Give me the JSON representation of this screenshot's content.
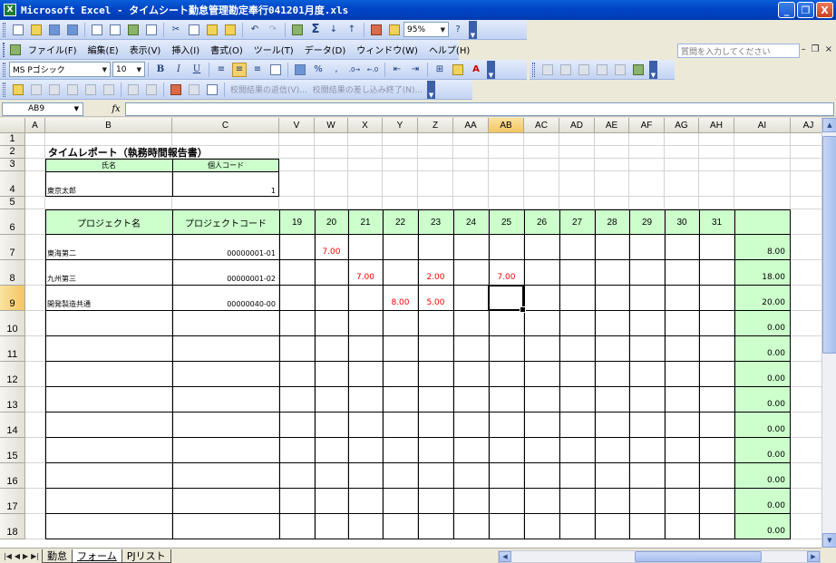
{
  "window": {
    "title": "Microsoft Excel - タイムシート勤怠管理勘定奉行041201月度.xls",
    "app_icon": "X",
    "controls": [
      "_",
      "❐",
      "X"
    ]
  },
  "menu": {
    "items": [
      "ファイル(F)",
      "編集(E)",
      "表示(V)",
      "挿入(I)",
      "書式(O)",
      "ツール(T)",
      "データ(D)",
      "ウィンドウ(W)",
      "ヘルプ(H)"
    ],
    "help_placeholder": "質問を入力してください",
    "mdi_controls": [
      "–",
      "❐",
      "×"
    ]
  },
  "toolbar": {
    "zoom": "95%",
    "font": "MS Pゴシック",
    "font_size": "10",
    "bold": "B",
    "italic": "I",
    "underline": "U",
    "percent": "%",
    "comma": ",",
    "review_send": "校閲結果の返信(V)...",
    "review_end": "校閲結果の差し込み終了(N)..."
  },
  "formula_bar": {
    "name_box": "AB9",
    "fx_label": "fx",
    "formula": ""
  },
  "columns": [
    "A",
    "B",
    "C",
    "V",
    "W",
    "X",
    "Y",
    "Z",
    "AA",
    "AB",
    "AC",
    "AD",
    "AE",
    "AF",
    "AG",
    "AH",
    "AI",
    "AJ"
  ],
  "active_column": "AB",
  "rows": [
    "1",
    "2",
    "3",
    "4",
    "5",
    "6",
    "7",
    "8",
    "9",
    "10",
    "11",
    "12",
    "13",
    "14",
    "15",
    "16",
    "17",
    "18"
  ],
  "active_row": "9",
  "sheet": {
    "title": "タイムレポート（執務時間報告書）",
    "name_label": "氏名",
    "code_label": "個人コード",
    "employee_name": "東京太郎",
    "employee_code": "1",
    "header_project_name": "プロジェクト名",
    "header_project_code": "プロジェクトコード",
    "day_headers": [
      "19",
      "20",
      "21",
      "22",
      "23",
      "24",
      "25",
      "26",
      "27",
      "28",
      "29",
      "30",
      "31"
    ],
    "projects": [
      {
        "name": "東海第二",
        "code": "00000001-01",
        "hours": [
          "",
          "7.00",
          "",
          "",
          "",
          "",
          "",
          "",
          "",
          "",
          "",
          "",
          ""
        ],
        "total": "8.00"
      },
      {
        "name": "九州第三",
        "code": "00000001-02",
        "hours": [
          "",
          "",
          "7.00",
          "",
          "2.00",
          "",
          "7.00",
          "",
          "",
          "",
          "",
          "",
          ""
        ],
        "total": "18.00"
      },
      {
        "name": "開発製造共通",
        "code": "00000040-00",
        "hours": [
          "",
          "",
          "",
          "8.00",
          "5.00",
          "",
          "",
          "",
          "",
          "",
          "",
          "",
          ""
        ],
        "total": "20.00"
      }
    ],
    "empty_totals": [
      "0.00",
      "0.00",
      "0.00",
      "0.00",
      "0.00",
      "0.00",
      "0.00",
      "0.00",
      "0.00"
    ]
  },
  "sheet_tabs": [
    "勤怠",
    "フォーム",
    "PJリスト"
  ],
  "active_tab": "フォーム",
  "colors": {
    "header_fill": "#ccffcc",
    "hour_text": "#ff0000",
    "active_header": "#f3c561"
  }
}
